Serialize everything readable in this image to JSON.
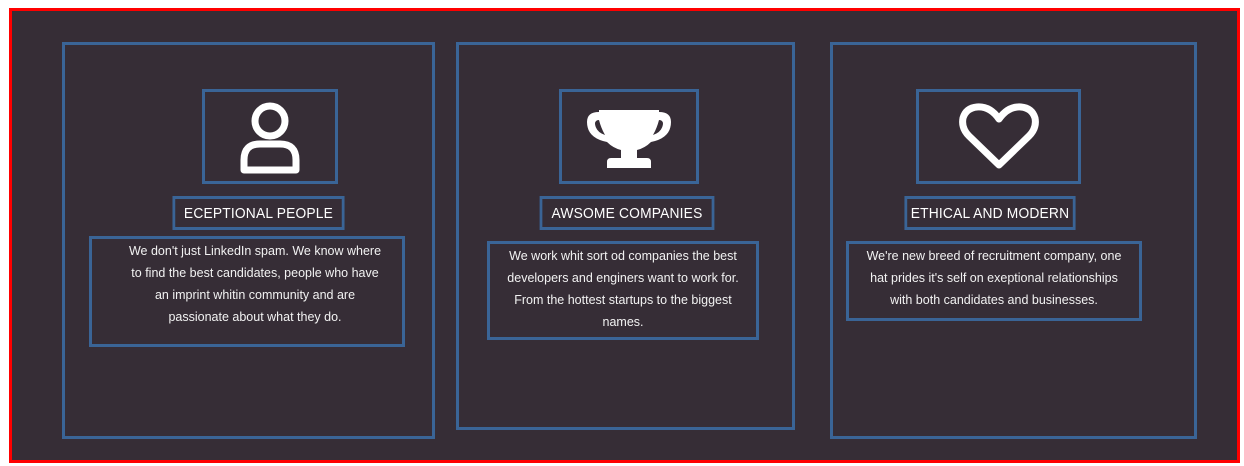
{
  "features": [
    {
      "icon": "user-icon",
      "title": "ECEPTIONAL PEOPLE",
      "lines": [
        "We don't just LinkedIn spam. We know where",
        "to find the best candidates, people who have",
        "an imprint whitin community and are",
        "passionate about what they do."
      ]
    },
    {
      "icon": "trophy-icon",
      "title": "AWSOME COMPANIES",
      "lines": [
        "We work whit sort od companies the best",
        "developers and enginers want to work for.",
        "From the hottest startups to the biggest",
        "names."
      ]
    },
    {
      "icon": "heart-icon",
      "title": "ETHICAL AND MODERN",
      "lines": [
        "We're new breed of recruitment company, one",
        "hat prides it's self on exeptional relationships",
        "with both candidates and businesses."
      ]
    }
  ],
  "colors": {
    "background": "#362d36",
    "outline": "#3a6496",
    "frame": "#ff0000",
    "text": "#ffffff"
  }
}
